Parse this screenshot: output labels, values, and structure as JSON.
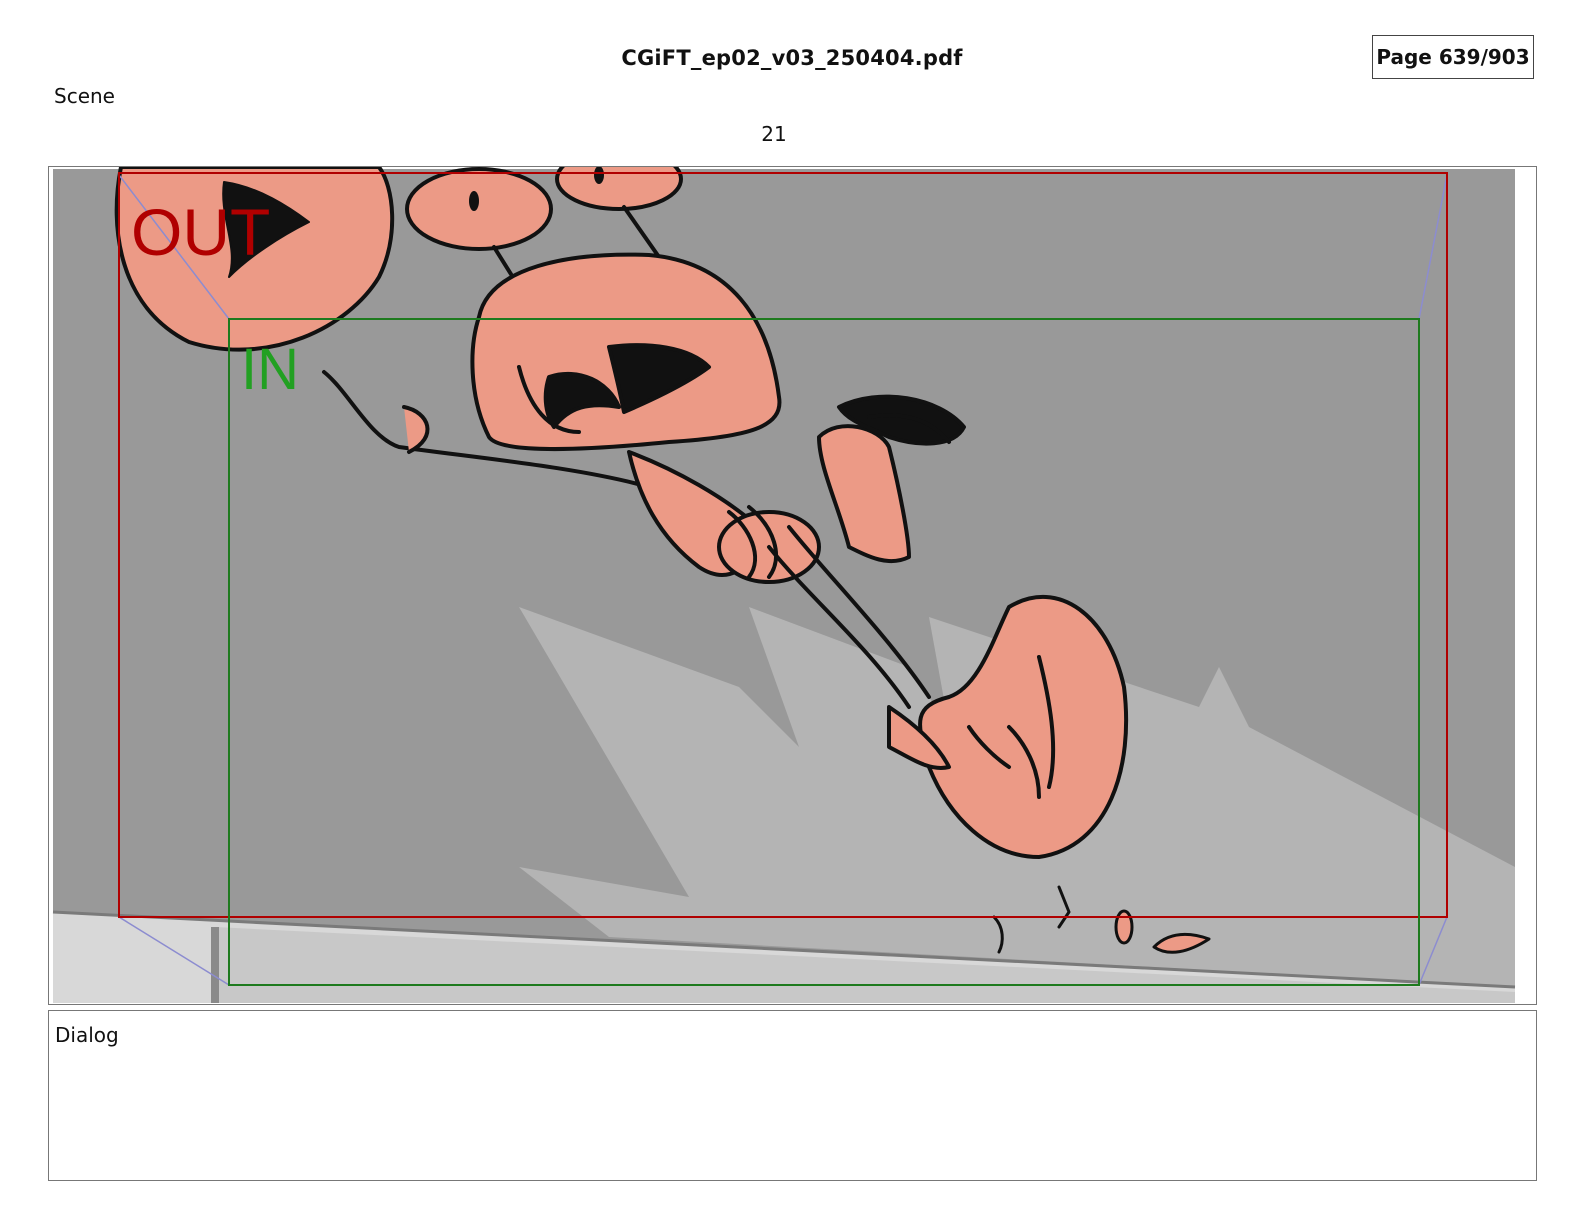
{
  "document": {
    "filename": "CGiFT_ep02_v03_250404.pdf",
    "page_indicator": "Page 639/903"
  },
  "scene": {
    "label": "Scene",
    "number": "21"
  },
  "panel": {
    "out_label": "OUT",
    "in_label": "IN",
    "colors": {
      "background_dark": "#999999",
      "background_light": "#b4b4b4",
      "floor": "#d6d6d6",
      "skin": "#ec9a86",
      "ink": "#111111",
      "out_frame": "#b00000",
      "in_frame": "#1e7a1e",
      "camera_guides": "#8c8cd0"
    }
  },
  "dialog": {
    "label": "Dialog",
    "text": ""
  }
}
